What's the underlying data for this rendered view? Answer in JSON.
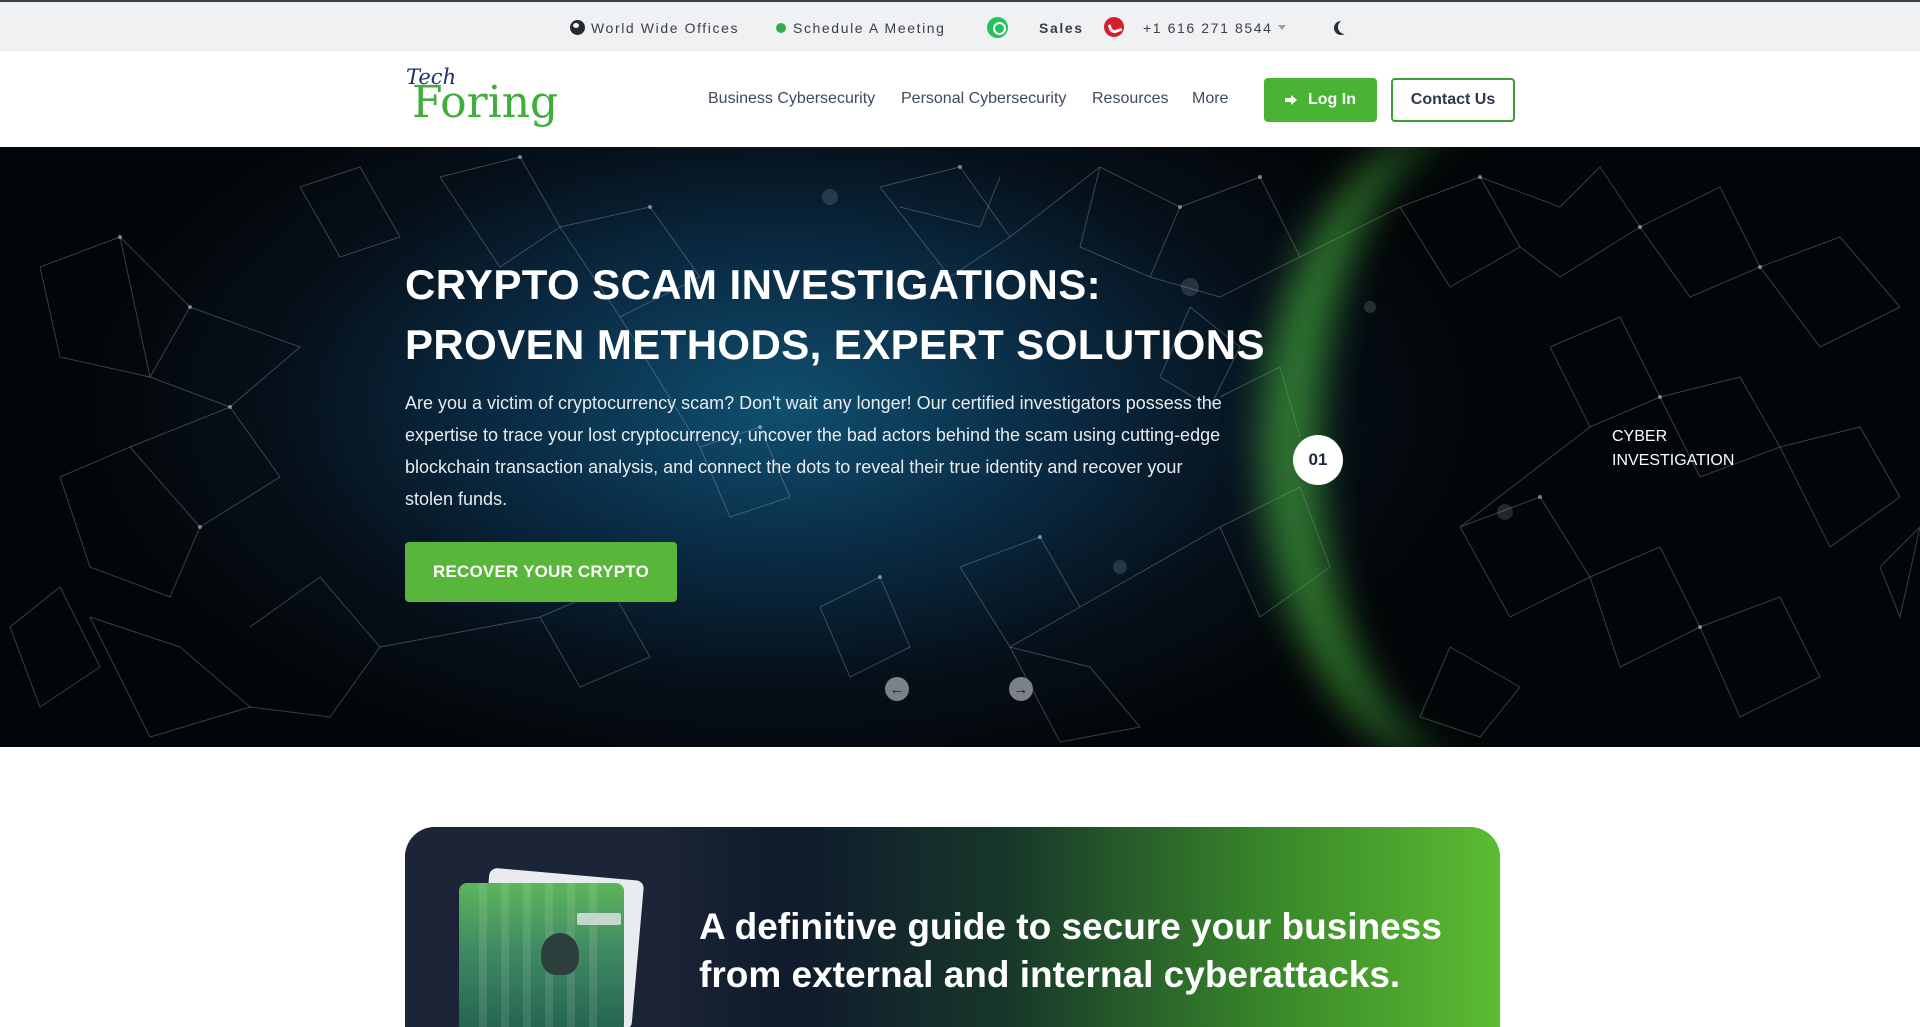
{
  "topbar": {
    "offices": "World Wide Offices",
    "meeting": "Schedule A Meeting",
    "sales": "Sales",
    "phone": "+1 616 271 8544",
    "icons": [
      "globe-icon",
      "status-dot-icon",
      "whatsapp-icon",
      "phone-icon",
      "caret-down-icon",
      "moon-icon"
    ]
  },
  "header": {
    "logo_top": "Tech",
    "logo_main": "Foring",
    "nav": [
      "Business Cybersecurity",
      "Personal Cybersecurity",
      "Resources",
      "More"
    ],
    "login_label": "Log In",
    "contact_label": "Contact Us"
  },
  "hero": {
    "title_line1": "CRYPTO SCAM INVESTIGATIONS:",
    "title_line2": "PROVEN METHODS, EXPERT SOLUTIONS",
    "text": "Are you a victim of cryptocurrency scam? Don't wait any longer! Our certified investigators possess the expertise to trace your lost cryptocurrency, uncover the bad actors behind the scam using cutting-edge blockchain transaction analysis, and connect the dots to reveal their true identity and recover your stolen funds.",
    "cta": "RECOVER YOUR CRYPTO",
    "slide_number": "01",
    "slide_label_1": "CYBER",
    "slide_label_2": "INVESTIGATION",
    "prev_arrow": "←",
    "next_arrow": "→"
  },
  "guide": {
    "title": "A definitive guide to secure your business from external and internal cyberattacks."
  },
  "colors": {
    "accent_green": "#49b334",
    "topbar_bg": "#f0f1f2",
    "hero_dark": "#06101a",
    "nav_text": "#3d4b5c"
  }
}
